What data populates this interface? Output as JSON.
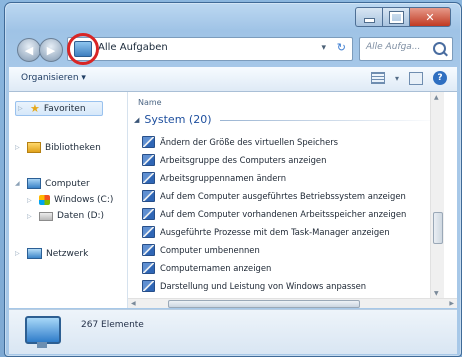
{
  "window": {
    "address": "Alle Aufgaben",
    "search_placeholder": "Alle Aufga..."
  },
  "toolbar": {
    "organize_label": "Organisieren ▾",
    "help_label": "?"
  },
  "nav_pane": {
    "items": [
      {
        "label": "Favoriten",
        "icon": "star-icon"
      },
      {
        "label": "Bibliotheken",
        "icon": "library-icon"
      },
      {
        "label": "Computer",
        "icon": "computer-icon"
      },
      {
        "label": "Windows (C:)",
        "icon": "windows-drive-icon"
      },
      {
        "label": "Daten (D:)",
        "icon": "drive-icon"
      },
      {
        "label": "Netzwerk",
        "icon": "network-icon"
      }
    ]
  },
  "list": {
    "column_header": "Name",
    "group_title": "System (20)",
    "items": [
      "Ändern der Größe des virtuellen Speichers",
      "Arbeitsgruppe des Computers anzeigen",
      "Arbeitsgruppennamen ändern",
      "Auf dem Computer ausgeführtes Betriebssystem anzeigen",
      "Auf dem Computer vorhandenen Arbeitsspeicher anzeigen",
      "Ausgeführte Prozesse mit dem Task-Manager anzeigen",
      "Computer umbenennen",
      "Computernamen anzeigen",
      "Darstellung und Leistung von Windows anpassen"
    ]
  },
  "details": {
    "count_text": "267 Elemente"
  },
  "colors": {
    "highlight_circle": "#d82525",
    "group_title": "#1e4f9e"
  }
}
